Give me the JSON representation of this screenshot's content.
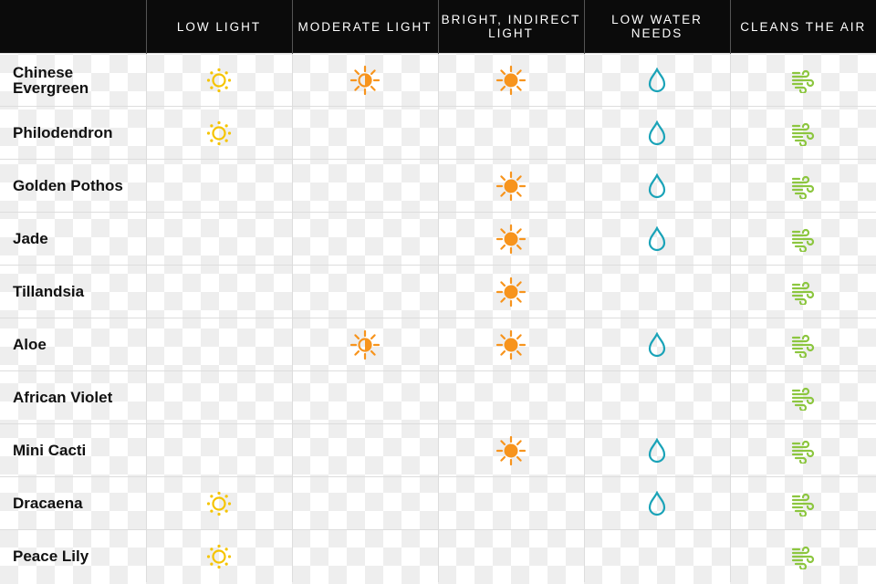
{
  "chart_data": {
    "type": "table",
    "columns": [
      "Low Light",
      "Moderate Light",
      "Bright, Indirect Light",
      "Low Water Needs",
      "Cleans the Air"
    ],
    "column_icons": [
      "sun-outline-icon",
      "sun-half-icon",
      "sun-filled-icon",
      "water-drop-icon",
      "wind-icon"
    ],
    "colors": {
      "low_light": "#f5c400",
      "moderate_light": "#f7941d",
      "bright_light": "#f7941d",
      "water": "#1aa3b8",
      "air": "#8cc63f",
      "header": "#0b0b0b"
    },
    "rows": [
      {
        "plant": "Chinese Evergreen",
        "values": [
          true,
          true,
          true,
          true,
          true
        ]
      },
      {
        "plant": "Philodendron",
        "values": [
          true,
          false,
          false,
          true,
          true
        ]
      },
      {
        "plant": "Golden Pothos",
        "values": [
          false,
          false,
          true,
          true,
          true
        ]
      },
      {
        "plant": "Jade",
        "values": [
          false,
          false,
          true,
          true,
          true
        ]
      },
      {
        "plant": "Tillandsia",
        "values": [
          false,
          false,
          true,
          false,
          true
        ]
      },
      {
        "plant": "Aloe",
        "values": [
          false,
          true,
          true,
          true,
          true
        ]
      },
      {
        "plant": "African Violet",
        "values": [
          false,
          false,
          false,
          false,
          true
        ]
      },
      {
        "plant": "Mini Cacti",
        "values": [
          false,
          false,
          true,
          true,
          true
        ]
      },
      {
        "plant": "Dracaena",
        "values": [
          true,
          false,
          false,
          true,
          true
        ]
      },
      {
        "plant": "Peace Lily",
        "values": [
          true,
          false,
          false,
          false,
          true
        ]
      }
    ]
  }
}
